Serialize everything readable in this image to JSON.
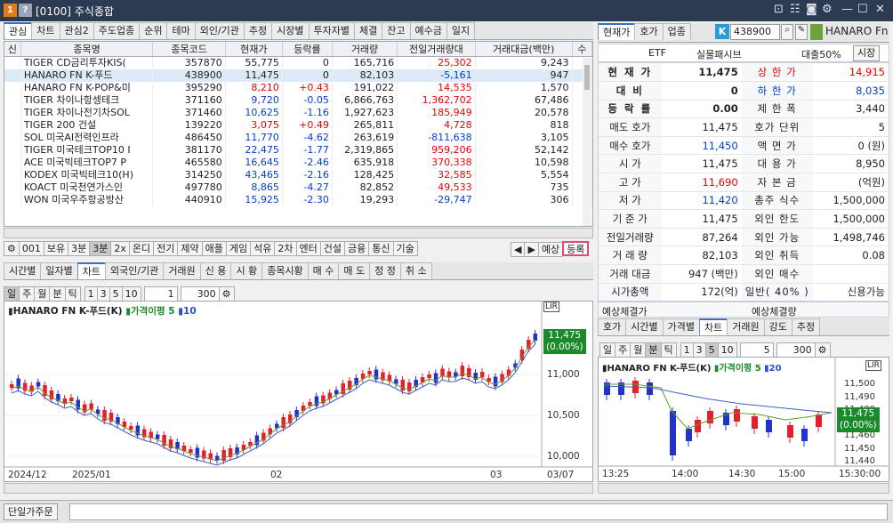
{
  "window": {
    "screen_no": "[0100]",
    "title": "주식종합",
    "logo_text": "1",
    "help_text": "?"
  },
  "left": {
    "tabs": [
      "관심",
      "차트",
      "관심2",
      "주도업종",
      "순위",
      "테마",
      "외인/기관",
      "추정",
      "시장별",
      "투자자별",
      "체결",
      "잔고",
      "예수금",
      "일지"
    ],
    "active_tab": "관심",
    "columns": [
      "신",
      "종목명",
      "종목코드",
      "현재가",
      "등락률",
      "거래량",
      "전일거래량대",
      "거래대금(백만)",
      "수"
    ],
    "rows": [
      {
        "name": "TIGER CD금리투자KIS(",
        "code": "357870",
        "price": "55,775",
        "rate": "0",
        "vol": "165,716",
        "prev": "25,302",
        "amt": "9,243",
        "pc": "",
        "rc": "",
        "vc": "red"
      },
      {
        "name": "HANARO FN K-푸드",
        "code": "438900",
        "price": "11,475",
        "rate": "0",
        "vol": "82,103",
        "prev": "-5,161",
        "amt": "947",
        "pc": "",
        "rc": "",
        "vc": "blue",
        "sel": true
      },
      {
        "name": "HANARO FN K-POP&미",
        "code": "395290",
        "price": "8,210",
        "rate": "+0.43",
        "vol": "191,022",
        "prev": "14,535",
        "amt": "1,570",
        "pc": "red",
        "rc": "red",
        "vc": "red"
      },
      {
        "name": "TIGER 차이나항셍테크",
        "code": "371160",
        "price": "9,720",
        "rate": "-0.05",
        "vol": "6,866,763",
        "prev": "1,362,702",
        "amt": "67,486",
        "pc": "blue",
        "rc": "blue",
        "vc": "red"
      },
      {
        "name": "TIGER 차이나전기차SOL",
        "code": "371460",
        "price": "10,625",
        "rate": "-1.16",
        "vol": "1,927,623",
        "prev": "185,949",
        "amt": "20,578",
        "pc": "blue",
        "rc": "blue",
        "vc": "red"
      },
      {
        "name": "TIGER 200 건설",
        "code": "139220",
        "price": "3,075",
        "rate": "+0.49",
        "vol": "265,811",
        "prev": "4,728",
        "amt": "818",
        "pc": "red",
        "rc": "red",
        "vc": "red"
      },
      {
        "name": "SOL 미국AI전력인프라",
        "code": "486450",
        "price": "11,770",
        "rate": "-4.62",
        "vol": "263,619",
        "prev": "-811,638",
        "amt": "3,105",
        "pc": "blue",
        "rc": "blue",
        "vc": "blue"
      },
      {
        "name": "TIGER 미국테크TOP10 I",
        "code": "381170",
        "price": "22,475",
        "rate": "-1.77",
        "vol": "2,319,865",
        "prev": "959,206",
        "amt": "52,142",
        "pc": "blue",
        "rc": "blue",
        "vc": "red"
      },
      {
        "name": "ACE 미국빅테크TOP7 P",
        "code": "465580",
        "price": "16,645",
        "rate": "-2.46",
        "vol": "635,918",
        "prev": "370,338",
        "amt": "10,598",
        "pc": "blue",
        "rc": "blue",
        "vc": "red"
      },
      {
        "name": "KODEX 미국빅테크10(H)",
        "code": "314250",
        "price": "43,465",
        "rate": "-2.16",
        "vol": "128,425",
        "prev": "32,585",
        "amt": "5,554",
        "pc": "blue",
        "rc": "blue",
        "vc": "red"
      },
      {
        "name": "KOACT 미국천연가스인",
        "code": "497780",
        "price": "8,865",
        "rate": "-4.27",
        "vol": "82,852",
        "prev": "49,533",
        "amt": "735",
        "pc": "blue",
        "rc": "blue",
        "vc": "red"
      },
      {
        "name": "WON 미국우주항공방산",
        "code": "440910",
        "price": "15,925",
        "rate": "-2.30",
        "vol": "19,293",
        "prev": "-29,747",
        "amt": "306",
        "pc": "blue",
        "rc": "blue",
        "vc": "blue"
      }
    ],
    "toolbar": [
      "001",
      "보유",
      "3분",
      "3분",
      "2x",
      "온디",
      "전기",
      "제약",
      "애플",
      "게임",
      "석유",
      "2차",
      "엔터",
      "건설",
      "금융",
      "통신",
      "기술"
    ],
    "toolbar_right": [
      "예상",
      "등록"
    ],
    "subtabs": [
      "시간별",
      "일자별",
      "차트",
      "외국인/기관",
      "거래원",
      "신 용",
      "시 황",
      "종목시황",
      "매 수",
      "매 도",
      "정 정",
      "취 소"
    ],
    "active_subtab": "차트",
    "period": [
      "일",
      "주",
      "월",
      "분",
      "틱"
    ],
    "period_nums": [
      "1",
      "3",
      "5",
      "10"
    ],
    "period_select": "1",
    "count": "300"
  },
  "main_chart": {
    "legend_name": "HANARO FN K-푸드(K)",
    "legend_ma": "가격이평 5",
    "legend_ma2": "10",
    "price_label": "11,475",
    "price_pct": "(0.00%)",
    "y_ticks": [
      "11,000",
      "10,500",
      "10,000"
    ],
    "x_labels": [
      "2024/12",
      "2025/01",
      "02",
      "03",
      "03/07"
    ],
    "box_label": "LIR"
  },
  "right": {
    "tabs": [
      "현재가",
      "호가",
      "업종"
    ],
    "active_tab": "현재가",
    "code": "438900",
    "name": "HANARO Fn",
    "type": "ETF",
    "type2": "실물패시브",
    "margin": "대출50%",
    "market_btn": "시장",
    "quote": [
      [
        "현 재 가",
        "11,475",
        "",
        "상 한 가",
        "14,915",
        "red"
      ],
      [
        "대   비",
        "0",
        "",
        "하 한 가",
        "8,035",
        "blue"
      ],
      [
        "등 락 률",
        "0.00",
        "",
        "제 한 폭",
        "3,440",
        ""
      ],
      [
        "매도 호가",
        "11,475",
        "",
        "호가 단위",
        "5",
        ""
      ],
      [
        "매수 호가",
        "11,450",
        "blue",
        "액 면 가",
        "0 (원)",
        ""
      ],
      [
        "시   가",
        "11,475",
        "",
        "대 용 가",
        "8,950",
        ""
      ],
      [
        "고   가",
        "11,690",
        "red",
        "자 본 금",
        "(억원)",
        ""
      ],
      [
        "저   가",
        "11,420",
        "blue",
        "총주 식수",
        "1,500,000",
        ""
      ],
      [
        "기 준 가",
        "11,475",
        "",
        "외인 한도",
        "1,500,000",
        ""
      ],
      [
        "전일거래량",
        "87,264",
        "",
        "외인 가능",
        "1,498,746",
        ""
      ],
      [
        "거 래 량",
        "82,103",
        "",
        "외인 취득",
        "0.08",
        ""
      ],
      [
        "거래 대금",
        "947 (백만)",
        "",
        "외인 매수",
        "",
        ""
      ],
      [
        "시가총액",
        "172(억)",
        "",
        "일반( 40% )",
        "신용가능",
        ""
      ]
    ],
    "expect_label1": "예상체결가",
    "expect_label2": "예상체결량",
    "subtabs": [
      "호가",
      "시간별",
      "가격별",
      "차트",
      "거래원",
      "강도",
      "추정"
    ],
    "active_subtab": "차트",
    "period": [
      "일",
      "주",
      "월",
      "분",
      "틱"
    ],
    "period_nums": [
      "1",
      "3",
      "5",
      "10"
    ],
    "period_select": "5",
    "count": "300"
  },
  "mini_chart": {
    "legend_name": "HANARO FN K-푸드(K)",
    "legend_ma": "가격이평 5",
    "legend_ma2": "20",
    "price_label": "11,475",
    "price_pct": "(0.00%)",
    "y_ticks": [
      "11,500",
      "11,490",
      "11,480",
      "11,470",
      "11,460",
      "11,450",
      "11,440"
    ],
    "x_labels": [
      "13:25",
      "14:00",
      "14:30",
      "15:00",
      "15:30:00"
    ],
    "box_label": "LIR"
  },
  "statusbar": {
    "order_btn": "단일가주문"
  }
}
